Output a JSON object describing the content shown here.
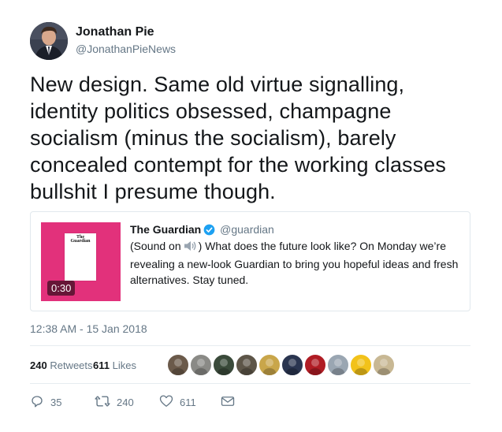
{
  "author": {
    "name": "Jonathan Pie",
    "handle": "@JonathanPieNews"
  },
  "tweet": {
    "lines": [
      "New design. Same old virtue signalling,",
      "identity politics obsessed, champagne",
      "socialism (minus the socialism), barely",
      "concealed contempt for the working classes",
      "bullshit I presume though."
    ]
  },
  "quote": {
    "name": "The Guardian",
    "handle": "@guardian",
    "text_prefix": "(Sound on",
    "text_rest": ") What does the future look like? On Monday we’re revealing a new-look Guardian to bring you hopeful ideas and fresh alternatives. Stay tuned.",
    "media": {
      "duration": "0:30",
      "masthead_line1": "The",
      "masthead_line2": "Guardian",
      "background_color": "#e2317b"
    },
    "verified_color": "#1da1f2"
  },
  "timestamp": "12:38 AM - 15 Jan 2018",
  "stats": {
    "retweets_count": "240",
    "retweets_label": "Retweets",
    "likes_count": "611",
    "likes_label": "Likes"
  },
  "liker_avatars": [
    {
      "name": "liker-avatar-1",
      "color": "#6b5a4a"
    },
    {
      "name": "liker-avatar-2",
      "color": "#8a8a86"
    },
    {
      "name": "liker-avatar-3",
      "color": "#3a4a3a"
    },
    {
      "name": "liker-avatar-4",
      "color": "#5d5548"
    },
    {
      "name": "liker-avatar-5",
      "color": "#c9a64a"
    },
    {
      "name": "liker-avatar-6",
      "color": "#2a3550"
    },
    {
      "name": "liker-avatar-7",
      "color": "#b01c24"
    },
    {
      "name": "liker-avatar-8",
      "color": "#9aa6b2"
    },
    {
      "name": "liker-avatar-9",
      "color": "#f2c21a"
    },
    {
      "name": "liker-avatar-10",
      "color": "#c8b894"
    }
  ],
  "actions": {
    "replies_count": "35",
    "retweets_count": "240",
    "likes_count": "611"
  },
  "colors": {
    "text_primary": "#14171a",
    "text_secondary": "#657786",
    "border": "#e1e8ed"
  },
  "icons": [
    "verified-icon",
    "speaker-icon",
    "reply-icon",
    "retweet-icon",
    "like-icon",
    "message-icon"
  ]
}
